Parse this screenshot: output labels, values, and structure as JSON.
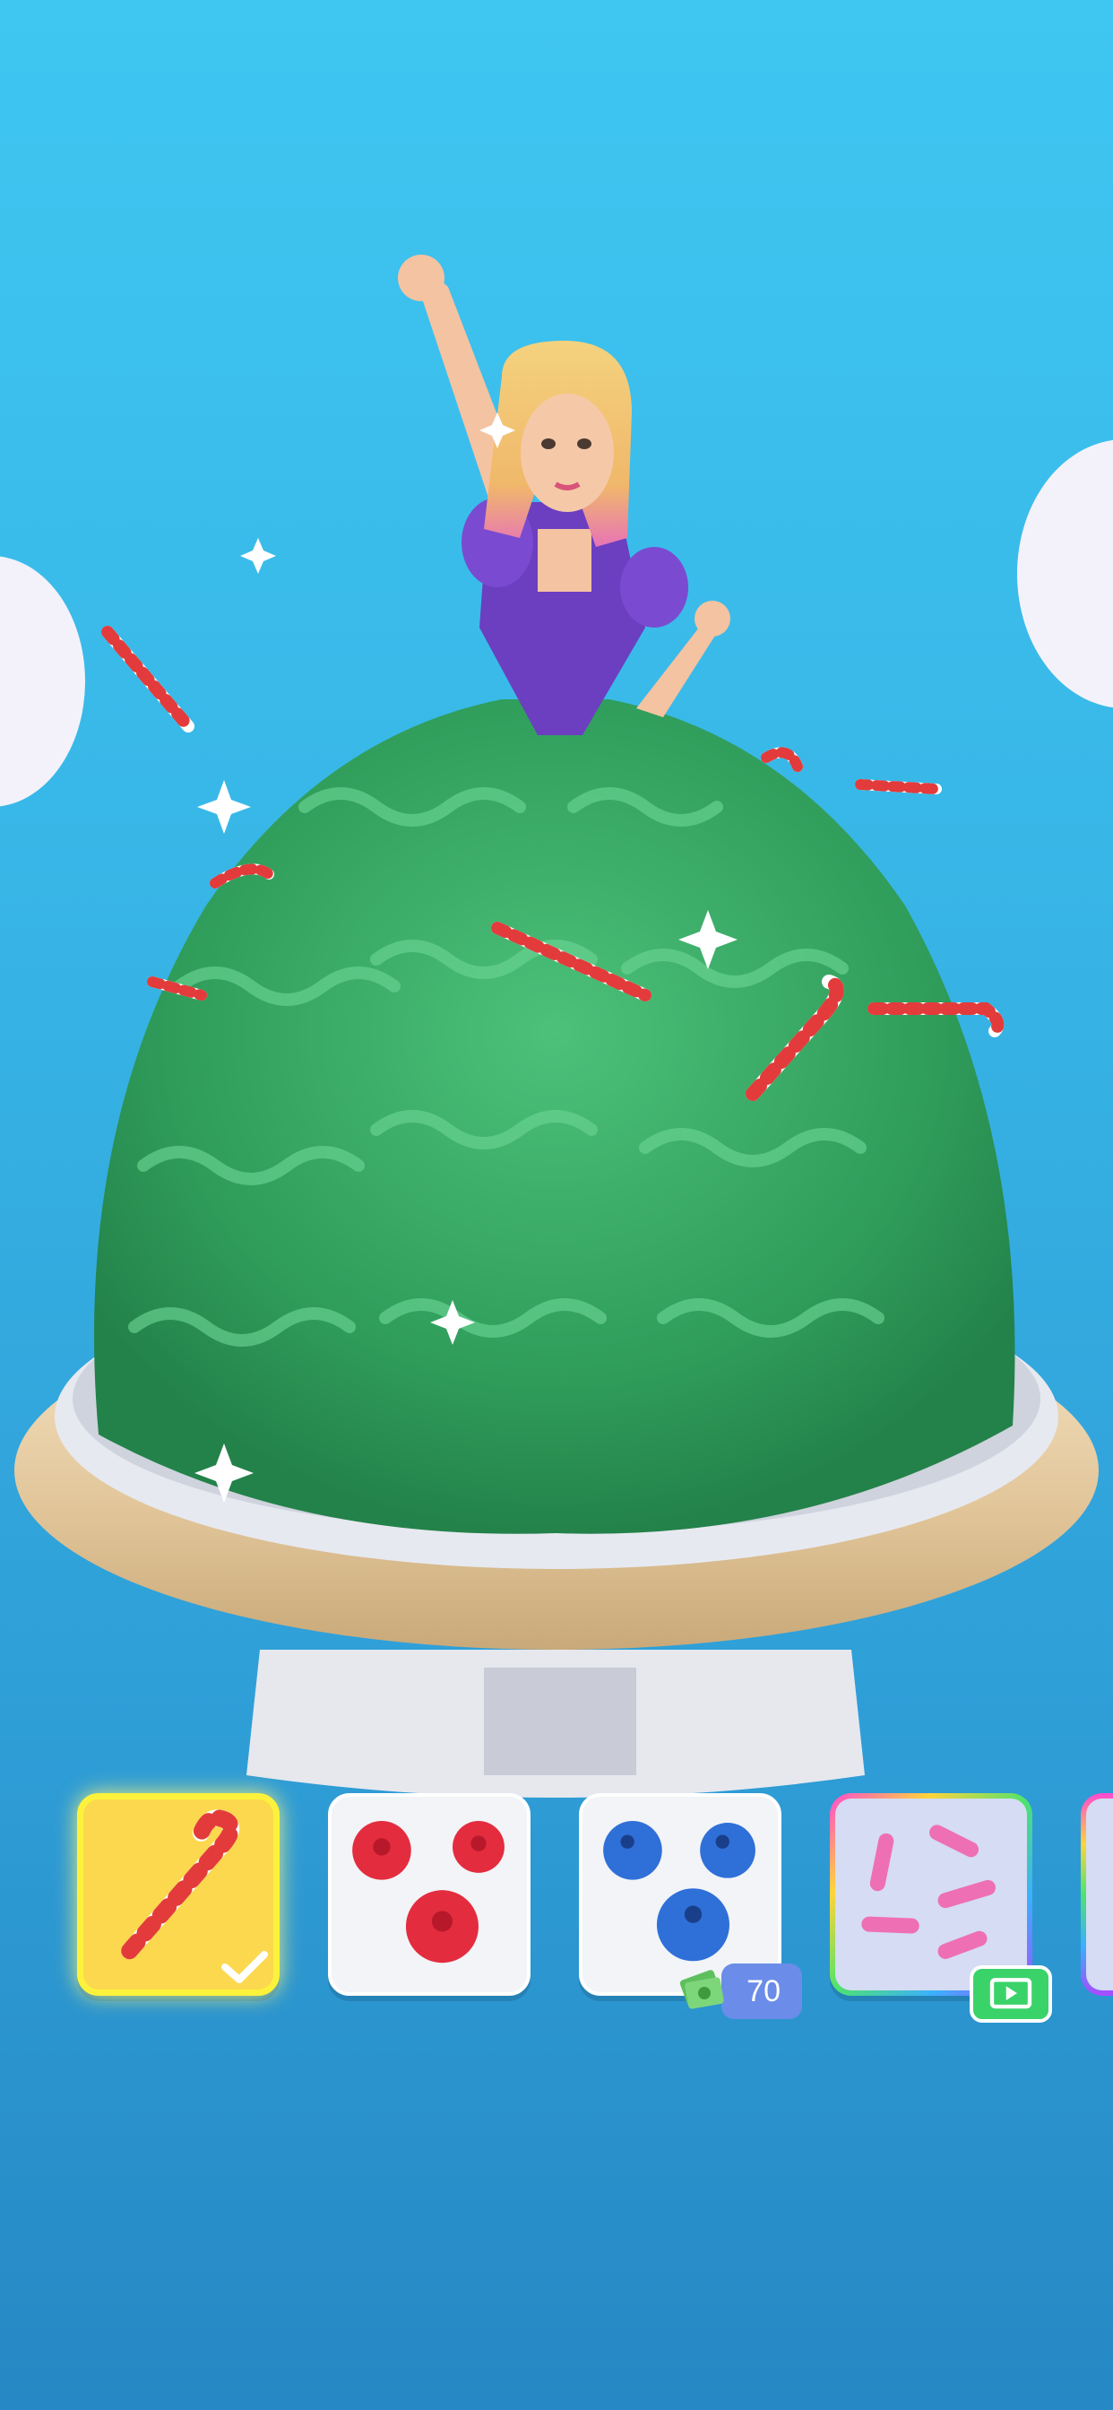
{
  "game": {
    "items": [
      {
        "id": "candy-cane",
        "selected": true,
        "purchased": true
      },
      {
        "id": "raspberries"
      },
      {
        "id": "blueberries",
        "price": "70",
        "currency_icon": "cash-icon"
      },
      {
        "id": "pink-sprinkles",
        "unlock": "video-ad-icon"
      },
      {
        "id": "partially-visible-item"
      }
    ]
  },
  "colors": {
    "sky_top": "#3fc6f1",
    "sky_bottom": "#2688c4",
    "dress_green": "#33a863",
    "selected_tile": "#fbd84e",
    "selected_border": "#fdf23b",
    "price_badge": "#6b8ce8",
    "video_badge": "#3ad36a"
  }
}
